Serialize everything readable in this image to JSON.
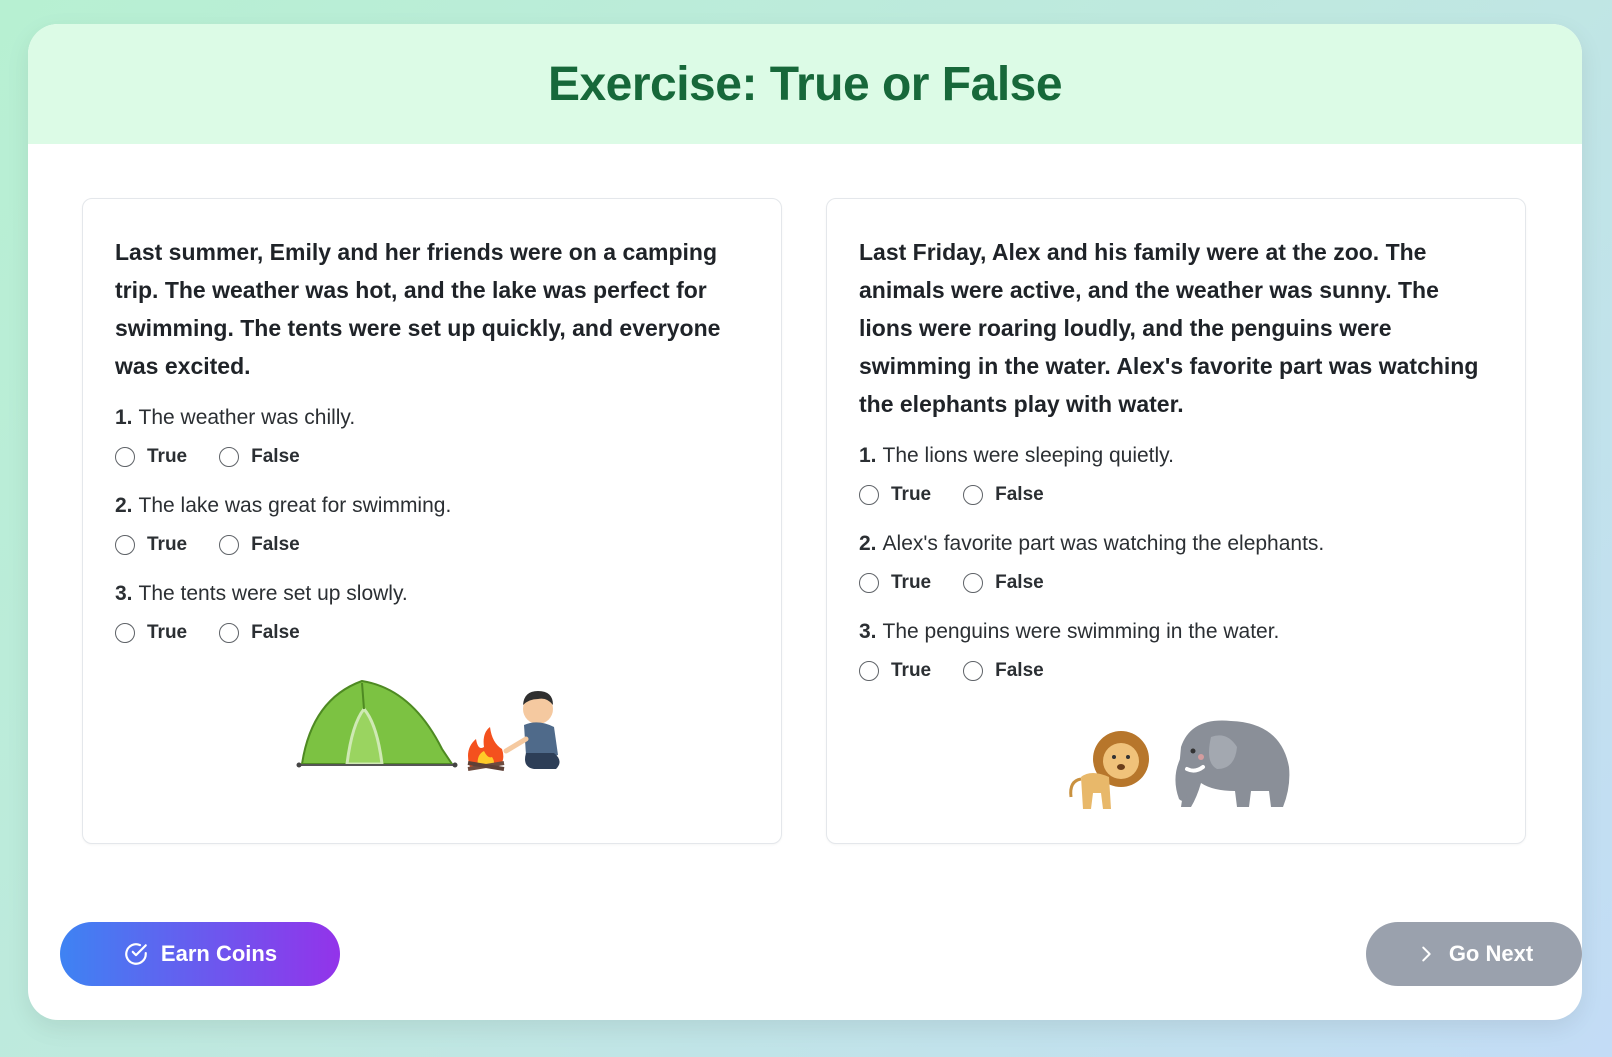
{
  "title": "Exercise: True or False",
  "exercises": [
    {
      "passage": "Last summer, Emily and her friends were on a camping trip. The weather was hot, and the lake was perfect for swimming. The tents were set up quickly, and everyone was excited.",
      "questions": [
        {
          "number": "1.",
          "text": "The weather was chilly.",
          "true_label": "True",
          "false_label": "False"
        },
        {
          "number": "2.",
          "text": "The lake was great for swimming.",
          "true_label": "True",
          "false_label": "False"
        },
        {
          "number": "3.",
          "text": "The tents were set up slowly.",
          "true_label": "True",
          "false_label": "False"
        }
      ],
      "illustration": "tent-and-campfire-icon"
    },
    {
      "passage": "Last Friday, Alex and his family were at the zoo. The animals were active, and the weather was sunny. The lions were roaring loudly, and the penguins were swimming in the water. Alex's favorite part was watching the elephants play with water.",
      "questions": [
        {
          "number": "1.",
          "text": "The lions were sleeping quietly.",
          "true_label": "True",
          "false_label": "False"
        },
        {
          "number": "2.",
          "text": "Alex's favorite part was watching the elephants.",
          "true_label": "True",
          "false_label": "False"
        },
        {
          "number": "3.",
          "text": "The penguins were swimming in the water.",
          "true_label": "True",
          "false_label": "False"
        }
      ],
      "illustration": "lion-and-elephant-icon"
    }
  ],
  "buttons": {
    "earn_coins": "Earn Coins",
    "go_next": "Go Next"
  },
  "colors": {
    "title": "#17683a",
    "header_bg": "#dcfbe6",
    "earn_gradient_start": "#3e83f3",
    "earn_gradient_end": "#9333ea",
    "go_next_bg": "#9aa1ad"
  }
}
